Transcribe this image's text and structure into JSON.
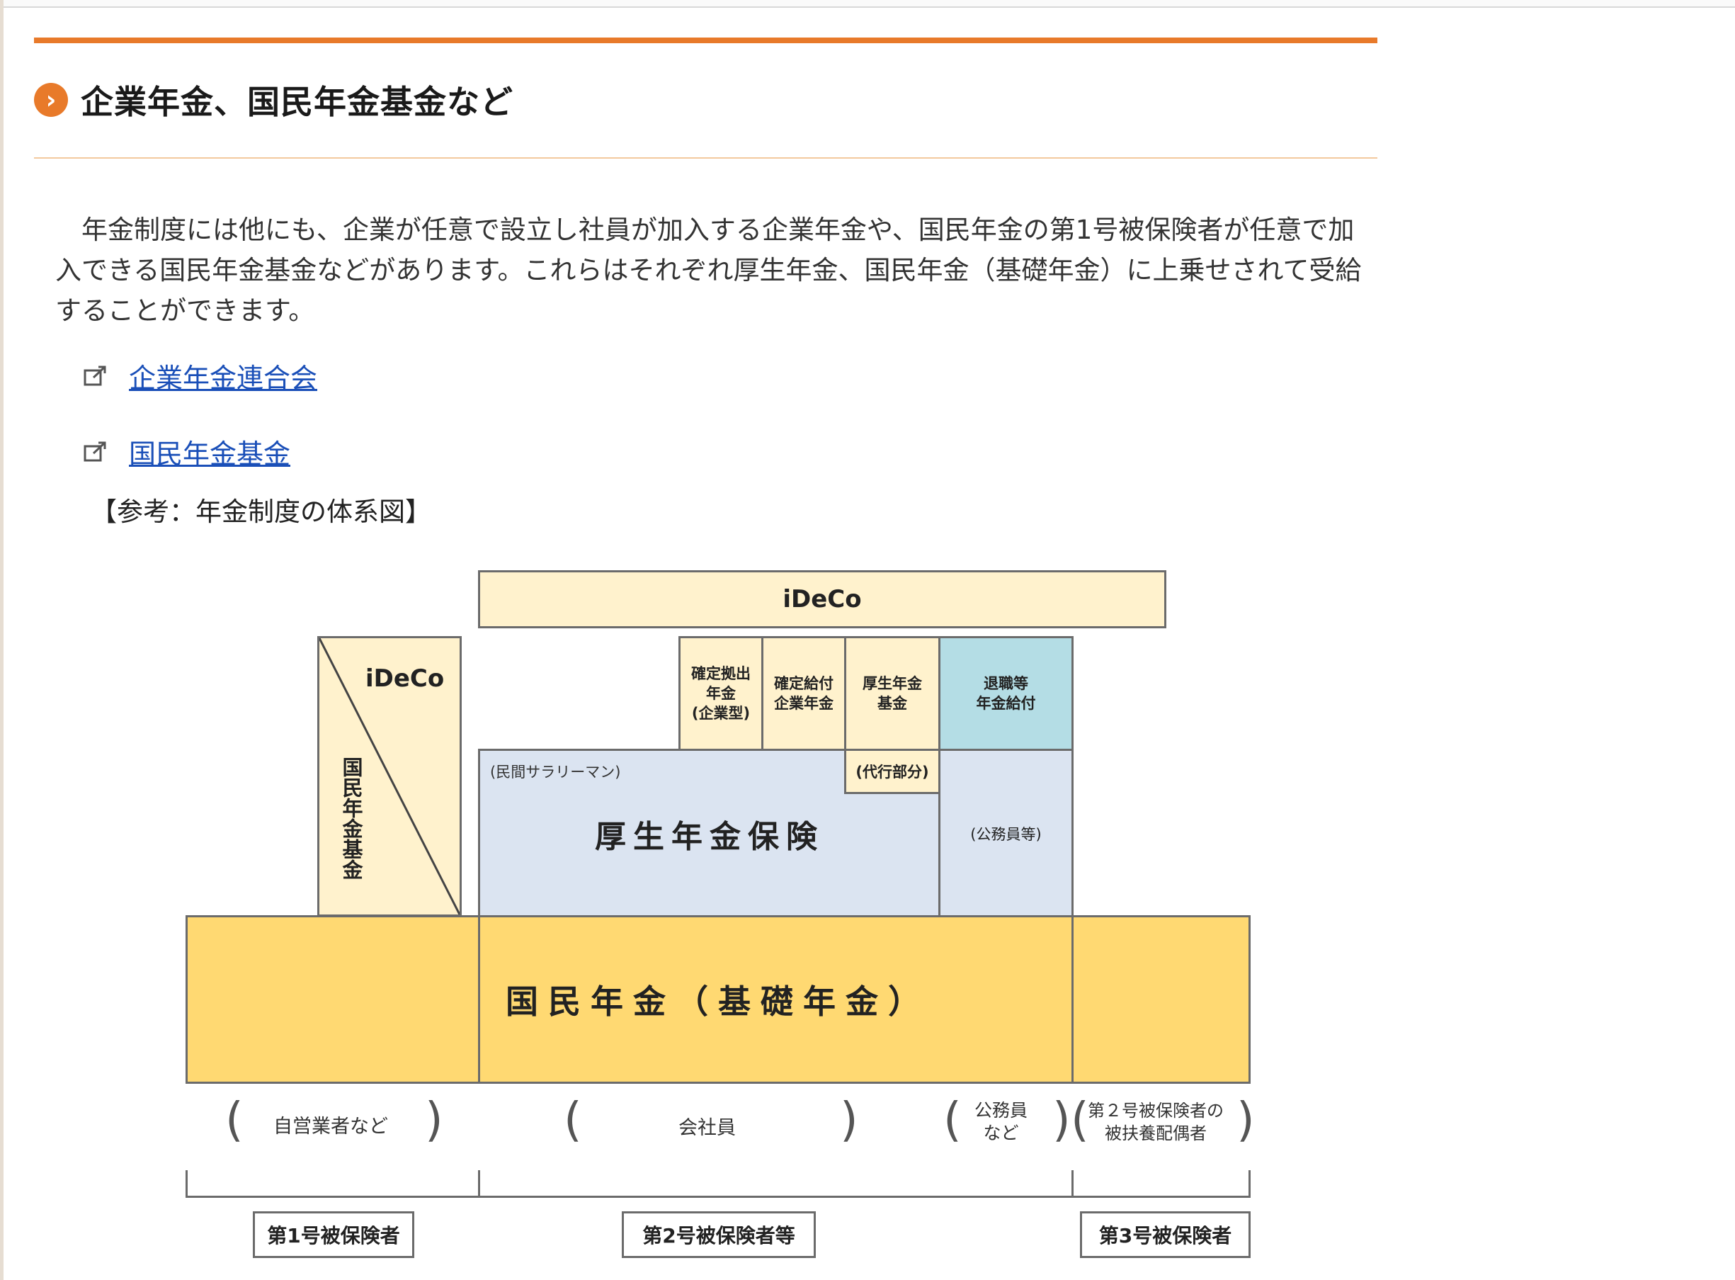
{
  "heading": {
    "icon": "chevron-right-circle-icon",
    "title": "企業年金、国民年金基金など"
  },
  "intro": "　年金制度には他にも、企業が任意で設立し社員が加入する企業年金や、国民年金の第1号被保険者が任意で加入できる国民年金基金などがあります。これらはそれぞれ厚生年金、国民年金（基礎年金）に上乗せされて受給することができます。",
  "links": [
    {
      "icon": "external-link-icon",
      "label": "企業年金連合会"
    },
    {
      "icon": "external-link-icon",
      "label": "国民年金基金"
    }
  ],
  "reference_label": "【参考：年金制度の体系図】",
  "diagram": {
    "ideco_top": "iDeCo",
    "ideco_left": "iDeCo",
    "kokumin_kikin": "国民年金基金",
    "kakutei_kyoshutsu": "確定拠出\n年金\n(企業型)",
    "kakutei_kyufu": "確定給付\n企業年金",
    "kosei_kikin": "厚生年金\n基金",
    "taishoku": "退職等\n年金給付",
    "minkan_salaryman": "(民間サラリーマン)",
    "daiko_bubun": "(代行部分)",
    "kosei_hoken": "厚生年金保険",
    "komuin_to": "(公務員等)",
    "kokumin_kiso": "国民年金（基礎年金）",
    "groups": {
      "jieigyo": "自営業者など",
      "kaishain": "会社員",
      "komuin": "公務員\nなど",
      "haigusha": "第２号被保険者の\n被扶養配偶者"
    },
    "categories": [
      "第1号被保険者",
      "第2号被保険者等",
      "第3号被保険者"
    ],
    "colors": {
      "cream": "#fff2cd",
      "blue": "#dbe4f1",
      "teal": "#b4dde5",
      "gold": "#ffd972",
      "accent": "#e87a2a"
    }
  }
}
